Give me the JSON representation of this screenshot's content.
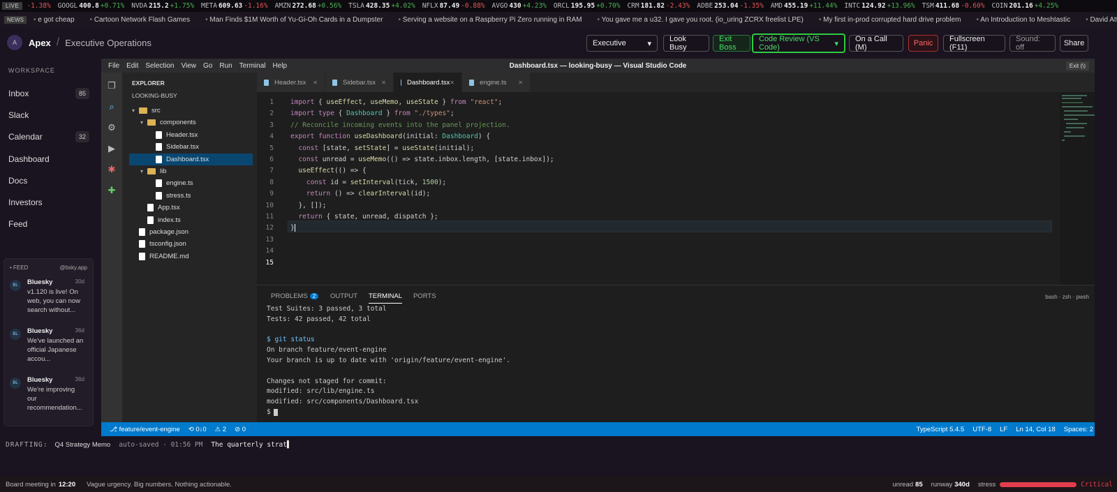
{
  "ticker": {
    "live": "LIVE",
    "items": [
      {
        "sym": "",
        "price": "",
        "chg": "-1.38%",
        "dir": "dn"
      },
      {
        "sym": "GOOGL",
        "price": "400.8",
        "chg": "+0.71%",
        "dir": "up"
      },
      {
        "sym": "NVDA",
        "price": "215.2",
        "chg": "+1.75%",
        "dir": "up"
      },
      {
        "sym": "META",
        "price": "609.63",
        "chg": "-1.16%",
        "dir": "dn"
      },
      {
        "sym": "AMZN",
        "price": "272.68",
        "chg": "+0.56%",
        "dir": "up"
      },
      {
        "sym": "TSLA",
        "price": "428.35",
        "chg": "+4.02%",
        "dir": "up"
      },
      {
        "sym": "NFLX",
        "price": "87.49",
        "chg": "-0.88%",
        "dir": "dn"
      },
      {
        "sym": "AVGO",
        "price": "430",
        "chg": "+4.23%",
        "dir": "up"
      },
      {
        "sym": "ORCL",
        "price": "195.95",
        "chg": "+0.70%",
        "dir": "up"
      },
      {
        "sym": "CRM",
        "price": "181.82",
        "chg": "-2.43%",
        "dir": "dn"
      },
      {
        "sym": "ADBE",
        "price": "253.04",
        "chg": "-1.35%",
        "dir": "dn"
      },
      {
        "sym": "AMD",
        "price": "455.19",
        "chg": "+11.44%",
        "dir": "up"
      },
      {
        "sym": "INTC",
        "price": "124.92",
        "chg": "+13.96%",
        "dir": "up"
      },
      {
        "sym": "TSM",
        "price": "411.68",
        "chg": "-0.60%",
        "dir": "dn"
      },
      {
        "sym": "COIN",
        "price": "201.16",
        "chg": "+4.25%",
        "dir": "up"
      }
    ]
  },
  "news": {
    "tag": "NEWS",
    "items": [
      "e got cheap",
      "Cartoon Network Flash Games",
      "Man Finds $1M Worth of Yu-Gi-Oh Cards in a Dumpster",
      "Serving a website on a Raspberry Pi Zero running in RAM",
      "You gave me a u32. I gave you root. (io_uring ZCRX freelist LPE)",
      "My first in-prod corrupted hard drive problem",
      "An Introduction to Meshtastic",
      "David Attenborou"
    ]
  },
  "header": {
    "logo": "A",
    "brand": "Apex",
    "sep": "/",
    "crumb": "Executive Operations",
    "mode": "Executive",
    "look_busy": "Look Busy",
    "exit_boss": "Exit Boss",
    "disguise": "Code Review (VS Code)",
    "on_call": "On a Call (M)",
    "panic": "Panic",
    "fullscreen": "Fullscreen (F11)",
    "sound": "Sound: off",
    "share": "Share"
  },
  "sidebar": {
    "section": "WORKSPACE",
    "items": [
      {
        "label": "Inbox",
        "badge": "85"
      },
      {
        "label": "Slack",
        "badge": ""
      },
      {
        "label": "Calendar",
        "badge": "32"
      },
      {
        "label": "Dashboard",
        "badge": ""
      },
      {
        "label": "Docs",
        "badge": ""
      },
      {
        "label": "Investors",
        "badge": ""
      },
      {
        "label": "Feed",
        "badge": ""
      }
    ]
  },
  "feed": {
    "title": "FEED",
    "source": "@bsky.app",
    "items": [
      {
        "avatar": "BL",
        "name": "Bluesky",
        "age": "30d",
        "text": "v1.120 is live! On web, you can now search without..."
      },
      {
        "avatar": "BL",
        "name": "Bluesky",
        "age": "36d",
        "text": "We've launched an official Japanese accou..."
      },
      {
        "avatar": "BL",
        "name": "Bluesky",
        "age": "36d",
        "text": "We're improving our recommendation..."
      }
    ]
  },
  "vscode": {
    "menu": [
      "File",
      "Edit",
      "Selection",
      "View",
      "Go",
      "Run",
      "Terminal",
      "Help"
    ],
    "title": "Dashboard.tsx — looking-busy — Visual Studio Code",
    "exit": "Exit (\\)",
    "explorer": {
      "header": "EXPLORER",
      "root": "LOOKING-BUSY",
      "tree": [
        {
          "label": "src",
          "kind": "folder",
          "depth": 0
        },
        {
          "label": "components",
          "kind": "folder",
          "depth": 1
        },
        {
          "label": "Header.tsx",
          "kind": "file",
          "depth": 2
        },
        {
          "label": "Sidebar.tsx",
          "kind": "file",
          "depth": 2
        },
        {
          "label": "Dashboard.tsx",
          "kind": "file",
          "depth": 2,
          "selected": true
        },
        {
          "label": "lib",
          "kind": "folder",
          "depth": 1
        },
        {
          "label": "engine.ts",
          "kind": "file",
          "depth": 2
        },
        {
          "label": "stress.ts",
          "kind": "file",
          "depth": 2
        },
        {
          "label": "App.tsx",
          "kind": "file",
          "depth": 1
        },
        {
          "label": "index.ts",
          "kind": "file",
          "depth": 1
        },
        {
          "label": "package.json",
          "kind": "file",
          "depth": 0
        },
        {
          "label": "tsconfig.json",
          "kind": "file",
          "depth": 0
        },
        {
          "label": "README.md",
          "kind": "file",
          "depth": 0
        }
      ]
    },
    "tabs": [
      "Header.tsx",
      "Sidebar.tsx",
      "Dashboard.tsx",
      "engine.ts"
    ],
    "active_tab": "Dashboard.tsx",
    "line_numbers": [
      "1",
      "2",
      "3",
      "4",
      "5",
      "6",
      "7",
      "8",
      "9",
      "10",
      "11",
      "12",
      "13",
      "14",
      "15"
    ],
    "code": [
      "import { useEffect, useMemo, useState } from \"react\";",
      "import type { Dashboard } from \"./types\";",
      "// Reconcile incoming events into the panel projection.",
      "export function useDashboard(initial: Dashboard) {",
      "  const [state, setState] = useState(initial);",
      "  const unread = useMemo(() => state.inbox.length, [state.inbox]);",
      "  useEffect(() => {",
      "    const id = setInterval(tick, 1500);",
      "    return () => clearInterval(id);",
      "  }, []);",
      "  return { state, unread, dispatch };",
      "}",
      "",
      "",
      ""
    ],
    "panel": {
      "tabs": [
        "PROBLEMS",
        "OUTPUT",
        "TERMINAL",
        "PORTS"
      ],
      "problems_count": "2",
      "active": "TERMINAL",
      "shells": "bash · zsh · pwsh",
      "lines": [
        "Test Suites: 3 passed, 3 total",
        "Tests: 42 passed, 42 total",
        "",
        "$ git status",
        "On branch feature/event-engine",
        "Your branch is up to date with 'origin/feature/event-engine'.",
        "",
        "Changes not staged for commit:",
        "modified: src/lib/engine.ts",
        "modified: src/components/Dashboard.tsx",
        "$"
      ]
    },
    "status": {
      "branch": "⎇ feature/event-engine",
      "sync": "⟲ 0↓0",
      "problems": "⚠ 2",
      "errors": "⊘ 0",
      "lang": "TypeScript 5.4.5",
      "enc": "UTF-8",
      "eol": "LF",
      "pos": "Ln 14, Col 18",
      "spaces": "Spaces: 2"
    }
  },
  "drafting": {
    "label": "DRAFTING:",
    "doc": "Q4 Strategy Memo",
    "saved": "auto-saved · 01:56 PM",
    "text": "The quarterly strat"
  },
  "bottom": {
    "meeting": "Board meeting in",
    "time": "12:20",
    "tagline": "Vague urgency. Big numbers. Nothing actionable.",
    "unread_label": "unread",
    "unread": "85",
    "runway_label": "runway",
    "runway": "340d",
    "stress_label": "stress",
    "stress_value": "Critical",
    "stress_level": 1.0
  },
  "colors": {
    "accent": "#007acc",
    "panic": "#e53d4d",
    "green": "#2ecc40"
  }
}
